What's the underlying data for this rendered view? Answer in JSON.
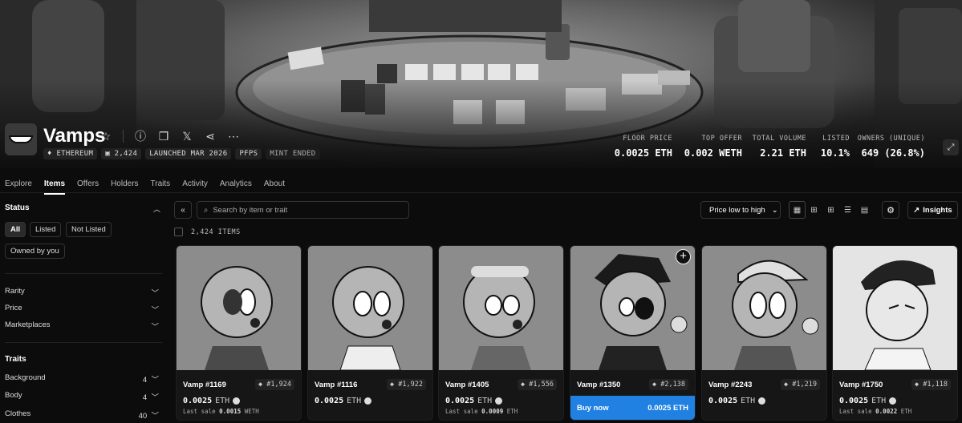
{
  "collection": {
    "name": "Vamps",
    "chips": [
      "ETHEREUM",
      "2,424",
      "LAUNCHED MAR 2026",
      "PFPS",
      "MINT ENDED"
    ]
  },
  "stats": [
    {
      "label": "FLOOR PRICE",
      "value": "0.0025 ETH"
    },
    {
      "label": "TOP OFFER",
      "value": "0.002 WETH"
    },
    {
      "label": "TOTAL VOLUME",
      "value": "2.21 ETH"
    },
    {
      "label": "LISTED",
      "value": "10.1%"
    },
    {
      "label": "OWNERS (UNIQUE)",
      "value": "649 (26.8%)"
    }
  ],
  "tabs": [
    "Explore",
    "Items",
    "Offers",
    "Holders",
    "Traits",
    "Activity",
    "Analytics",
    "About"
  ],
  "sidebar": {
    "status_title": "Status",
    "status_options": [
      "All",
      "Listed",
      "Not Listed",
      "Owned by you"
    ],
    "filters": [
      "Rarity",
      "Price",
      "Marketplaces"
    ],
    "traits_title": "Traits",
    "traits": [
      {
        "label": "Background",
        "count": "4"
      },
      {
        "label": "Body",
        "count": "4"
      },
      {
        "label": "Clothes",
        "count": "40"
      }
    ]
  },
  "toolbar": {
    "search_placeholder": "Search by item or trait",
    "sort_label": "Price low to high",
    "insights_label": "Insights",
    "items_count": "2,424 ITEMS"
  },
  "cards": [
    {
      "name": "Vamp #1169",
      "rank": "#1,924",
      "price": "0.0025",
      "unit": "ETH",
      "last_label": "Last sale",
      "last_value": "0.0015",
      "last_unit": "WETH"
    },
    {
      "name": "Vamp #1116",
      "rank": "#1,922",
      "price": "0.0025",
      "unit": "ETH",
      "last_label": "",
      "last_value": "",
      "last_unit": ""
    },
    {
      "name": "Vamp #1405",
      "rank": "#1,556",
      "price": "0.0025",
      "unit": "ETH",
      "last_label": "Last sale",
      "last_value": "0.0009",
      "last_unit": "ETH"
    },
    {
      "name": "Vamp #1350",
      "rank": "#2,138",
      "buy_label": "Buy now",
      "buy_price": "0.0025 ETH"
    },
    {
      "name": "Vamp #2243",
      "rank": "#1,219",
      "price": "0.0025",
      "unit": "ETH",
      "last_label": "",
      "last_value": "",
      "last_unit": ""
    },
    {
      "name": "Vamp #1750",
      "rank": "#1,118",
      "price": "0.0025",
      "unit": "ETH",
      "last_label": "Last sale",
      "last_value": "0.0022",
      "last_unit": "ETH"
    }
  ],
  "icons": {
    "star": "star-icon",
    "info": "info-icon",
    "copy": "copy-icon",
    "x": "x-icon",
    "share": "share-icon",
    "more": "more-icon"
  }
}
